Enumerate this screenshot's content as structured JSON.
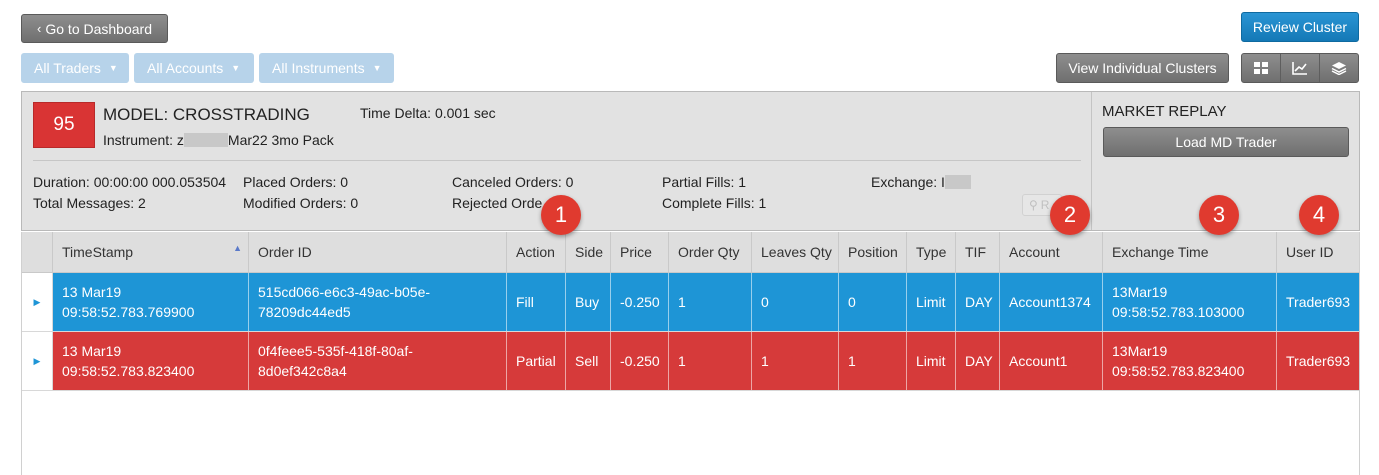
{
  "toolbar": {
    "back_label": "Go to Dashboard",
    "review_label": "Review Cluster",
    "view_clusters_label": "View Individual Clusters",
    "filters": [
      "All Traders",
      "All Accounts",
      "All Instruments"
    ]
  },
  "view_icons": [
    "grid-view-icon",
    "line-chart-icon",
    "layers-icon"
  ],
  "summary": {
    "score": "95",
    "model": "MODEL: CROSSTRADING",
    "instrument_prefix": "Instrument: z",
    "instrument_suffix": "Mar22 3mo Pack",
    "time_delta": "Time Delta: 0.001 sec",
    "duration": "Duration: 00:00:00 000.053504",
    "total_messages": "Total Messages: 2",
    "placed_orders": "Placed Orders: 0",
    "modified_orders": "Modified Orders: 0",
    "canceled_orders": "Canceled Orders: 0",
    "rejected_orders": "Rejected Orde",
    "partial_fills": "Partial Fills: 1",
    "complete_fills": "Complete Fills: 1",
    "exchange": "Exchange: I",
    "reset_label": "R"
  },
  "market_replay": {
    "title": "MARKET REPLAY",
    "button": "Load MD Trader"
  },
  "table": {
    "columns": [
      "TimeStamp",
      "Order ID",
      "Action",
      "Side",
      "Price",
      "Order Qty",
      "Leaves Qty",
      "Position",
      "Type",
      "TIF",
      "Account",
      "Exchange Time",
      "User ID"
    ],
    "rows": [
      {
        "timestamp_date": "13 Mar19",
        "timestamp_time": "09:58:52.783.769900",
        "order_id_1": "515cd066-e6c3-49ac-b05e-",
        "order_id_2": "78209dc44ed5",
        "action": "Fill",
        "side": "Buy",
        "price": "-0.250",
        "order_qty": "1",
        "leaves_qty": "0",
        "position": "0",
        "type": "Limit",
        "tif": "DAY",
        "account": "Account1374",
        "exch_date": "13Mar19",
        "exch_time": "09:58:52.783.103000",
        "user_id": "Trader693"
      },
      {
        "timestamp_date": "13 Mar19",
        "timestamp_time": "09:58:52.783.823400",
        "order_id_1": "0f4feee5-535f-418f-80af-",
        "order_id_2": "8d0ef342c8a4",
        "action": "Partial",
        "side": "Sell",
        "price": "-0.250",
        "order_qty": "1",
        "leaves_qty": "1",
        "position": "1",
        "type": "Limit",
        "tif": "DAY",
        "account": "Account1",
        "exch_date": "13Mar19",
        "exch_time": "09:58:52.783.823400",
        "user_id": "Trader693"
      }
    ]
  },
  "callouts": [
    "1",
    "2",
    "3",
    "4"
  ],
  "colors": {
    "fill_row": "#1e95d6",
    "partial_row": "#d63a3a",
    "score_bg": "#d93434",
    "callout": "#e03a2f"
  }
}
